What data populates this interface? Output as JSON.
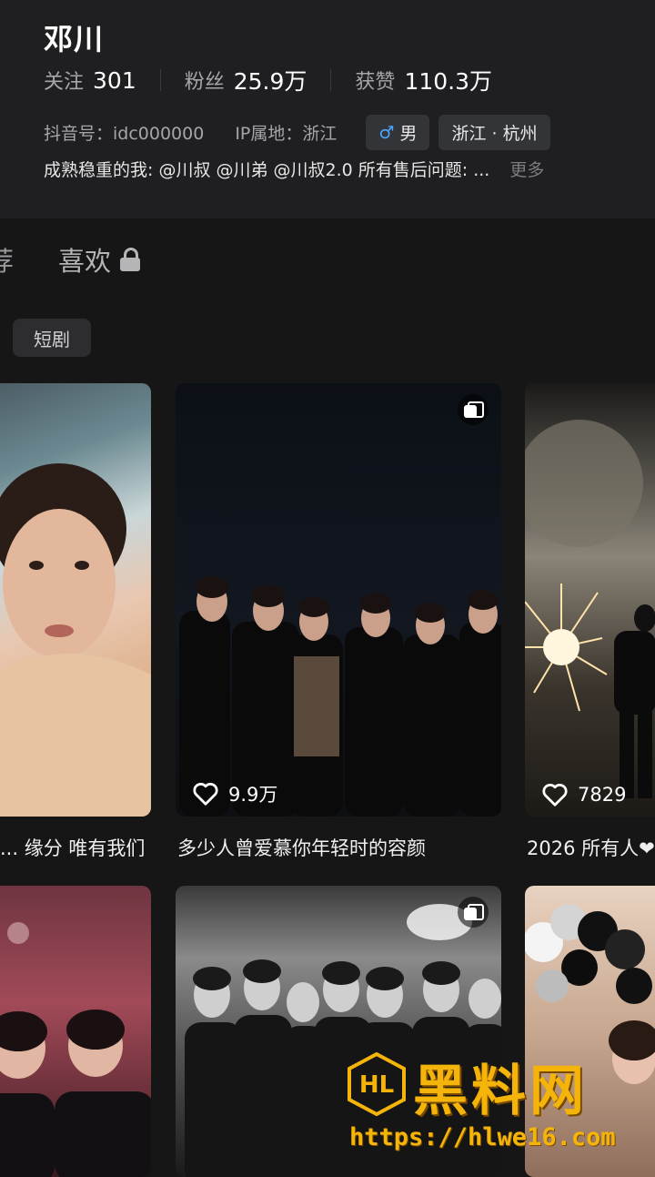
{
  "profile": {
    "name": "邓川",
    "following_label": "关注",
    "following_value": "301",
    "followers_label": "粉丝",
    "followers_value": "25.9万",
    "likes_label": "获赞",
    "likes_value": "110.3万",
    "douyin_id": "抖音号：idc000000",
    "ip_location": "IP属地：浙江",
    "gender_symbol": "♂",
    "gender": "男",
    "region": "浙江 · 杭州",
    "bio": "成熟稳重的我: @川叔  @川弟  @川叔2.0  所有售后问题: ...",
    "bio_more": "更多"
  },
  "tabs": {
    "recommend_partial": "荐",
    "likes": "喜欢"
  },
  "filter": {
    "label": "短剧"
  },
  "grid": {
    "row1": [
      {
        "likes": "",
        "caption": "缘分 唯有我们 ..."
      },
      {
        "likes": "9.9万",
        "caption": "多少人曾爱慕你年轻时的容颜"
      },
      {
        "likes": "7829",
        "caption": "2026 所有人❤"
      }
    ]
  },
  "watermark": {
    "text": "黑料网",
    "url": "https://hlwe16.com"
  },
  "icons": [
    "lock-icon",
    "heart-icon",
    "multi-image-icon",
    "male-icon"
  ],
  "colors": {
    "background": "#161616",
    "profile_bg": "#1f1f21",
    "chip_bg": "#333438",
    "male_blue": "#4aa8ff",
    "watermark_gold": "#f5b40a"
  }
}
